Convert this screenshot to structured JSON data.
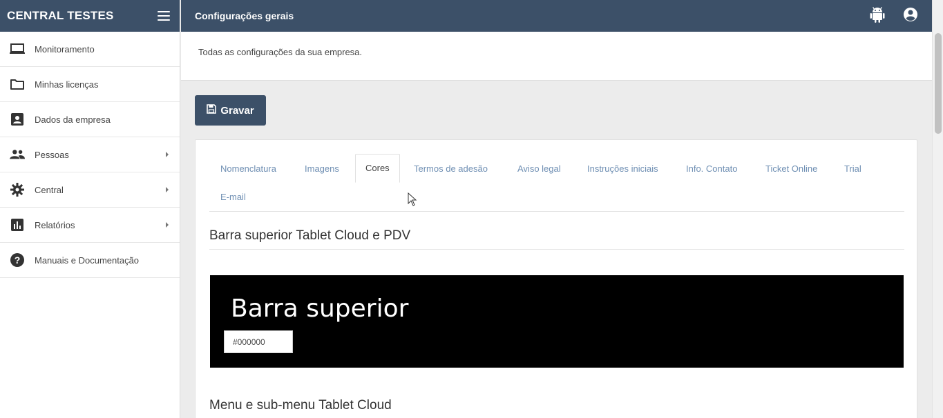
{
  "sidebar": {
    "brand": "CENTRAL TESTES",
    "items": [
      {
        "label": "Monitoramento",
        "icon": "monitor-icon",
        "submenu": false
      },
      {
        "label": "Minhas licenças",
        "icon": "folder-icon",
        "submenu": false
      },
      {
        "label": "Dados da empresa",
        "icon": "contact-card-icon",
        "submenu": false
      },
      {
        "label": "Pessoas",
        "icon": "people-icon",
        "submenu": true
      },
      {
        "label": "Central",
        "icon": "gear-icon",
        "submenu": true
      },
      {
        "label": "Relatórios",
        "icon": "bar-chart-icon",
        "submenu": true
      },
      {
        "label": "Manuais e Documentação",
        "icon": "help-icon",
        "submenu": false
      }
    ]
  },
  "header": {
    "title": "Configurações gerais",
    "icons": [
      "android-icon",
      "account-icon"
    ]
  },
  "page": {
    "description": "Todas as configurações da sua empresa.",
    "save_label": "Gravar"
  },
  "tabs": [
    {
      "label": "Nomenclatura"
    },
    {
      "label": "Imagens"
    },
    {
      "label": "Cores",
      "active": true
    },
    {
      "label": "Termos de adesão"
    },
    {
      "label": "Aviso legal"
    },
    {
      "label": "Instruções iniciais"
    },
    {
      "label": "Info. Contato"
    },
    {
      "label": "Ticket Online"
    },
    {
      "label": "Trial"
    },
    {
      "label": "E-mail"
    }
  ],
  "sections": {
    "top_bar_title": "Barra superior Tablet Cloud e PDV",
    "preview_text": "Barra superior",
    "color_value": "#000000",
    "menu_title": "Menu e sub-menu Tablet Cloud"
  },
  "colors": {
    "primary": "#3c5068",
    "tab_link": "#6f8fb3",
    "preview_bg": "#000000"
  }
}
